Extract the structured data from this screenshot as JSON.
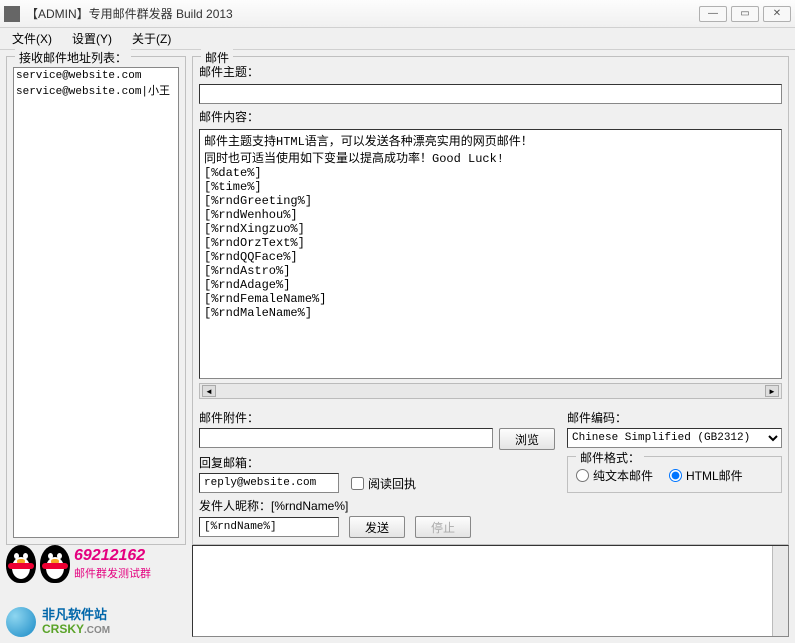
{
  "window": {
    "title": "【ADMIN】专用邮件群发器 Build 2013"
  },
  "menu": {
    "file": "文件(X)",
    "settings": "设置(Y)",
    "about": "关于(Z)"
  },
  "left": {
    "legend": "接收邮件地址列表：",
    "addresses": "service@website.com\nservice@website.com|小王"
  },
  "mail": {
    "legend": "邮件",
    "subject_label": "邮件主题：",
    "subject_value": "",
    "content_label": "邮件内容：",
    "content_value": "邮件主题支持HTML语言，可以发送各种漂亮实用的网页邮件！\n同时也可适当使用如下变量以提高成功率！Good Luck!\n[%date%]\n[%time%]\n[%rndGreeting%]\n[%rndWenhou%]\n[%rndXingzuo%]\n[%rndOrzText%]\n[%rndQQFace%]\n[%rndAstro%]\n[%rndAdage%]\n[%rndFemaleName%]\n[%rndMaleName%]",
    "attach_label": "邮件附件：",
    "attach_value": "",
    "browse_btn": "浏览",
    "reply_label": "回复邮箱：",
    "reply_value": "reply@website.com",
    "read_receipt": "阅读回执",
    "sender_label": "发件人昵称：[%rndName%]",
    "sender_value": "[%rndName%]",
    "send_btn": "发送",
    "stop_btn": "停止",
    "encode_label": "邮件编码：",
    "encode_value": "Chinese Simplified (GB2312)",
    "format_legend": "邮件格式：",
    "format_plain": "纯文本邮件",
    "format_html": "HTML邮件"
  },
  "promo": {
    "qq_number": "69212162",
    "qq_label": "邮件群发测试群",
    "site_name": "非凡软件站",
    "site_url_main": "CRSKY",
    "site_url_suffix": ".COM"
  }
}
